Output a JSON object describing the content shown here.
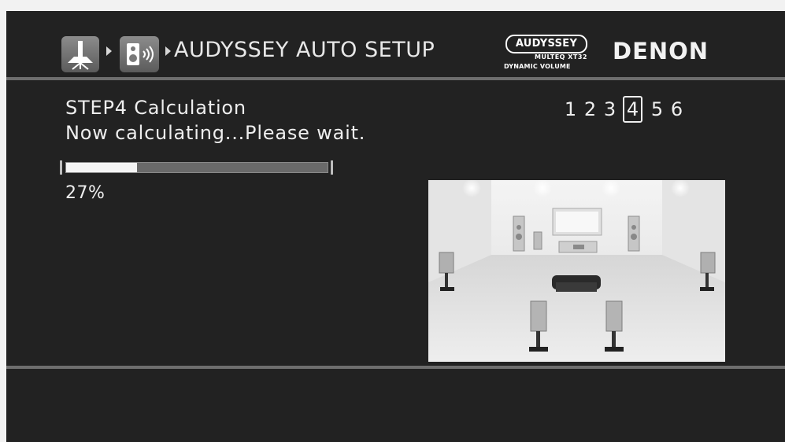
{
  "header": {
    "title": "AUDYSSEY AUTO SETUP",
    "nav_icons": [
      "setup-icon",
      "speaker-icon"
    ],
    "audyssey_logo": {
      "name": "AUDYSSEY",
      "line1": "MULTEQ XT32",
      "line2": "DYNAMIC VOLUME"
    },
    "brand": "DENON"
  },
  "step": {
    "title": "STEP4 Calculation",
    "message": "Now calculating...Please wait.",
    "steps": [
      "1",
      "2",
      "3",
      "4",
      "5",
      "6"
    ],
    "active_step": "4"
  },
  "progress": {
    "percent_label": "27%",
    "fraction": 0.27
  },
  "illustration": "speaker-room-illustration",
  "colors": {
    "screen_bg": "#222222",
    "text": "#eeeeee",
    "divider": "#6e6e6e",
    "progress_fill": "#f5f5f5",
    "progress_track": "#6a6a6a"
  }
}
